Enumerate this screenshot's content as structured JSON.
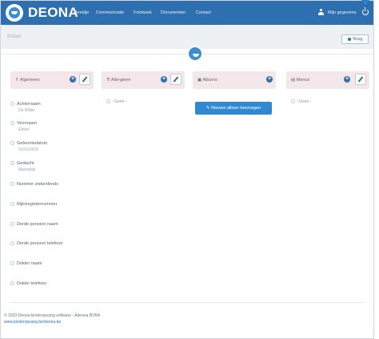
{
  "brand": "DEONA",
  "nav": {
    "links": [
      "Beeldje",
      "Communicatie",
      "Fotoboek",
      "Documenten",
      "Contact"
    ],
    "user_label": "Mijn gegevens"
  },
  "page": {
    "name": "Erbiet",
    "back_label": "Terug"
  },
  "columns": {
    "algemeen": {
      "title": "Algemeen",
      "fields": [
        {
          "label": "Achternaam",
          "value": "De Wilde"
        },
        {
          "label": "Voornaam",
          "value": "Erbiet"
        },
        {
          "label": "Geboortedatum",
          "value": "01/01/2019"
        },
        {
          "label": "Geslacht",
          "value": "Mannelijk"
        },
        {
          "label": "Nummer ziekenfonds",
          "value": ""
        },
        {
          "label": "Rijksregisternummer",
          "value": ""
        },
        {
          "label": "Derde persoon naam",
          "value": ""
        },
        {
          "label": "Derde persoon telefoon",
          "value": ""
        },
        {
          "label": "Dokter naam",
          "value": ""
        },
        {
          "label": "Dokter telefoon",
          "value": ""
        }
      ]
    },
    "allergieen": {
      "title": "Allergieen",
      "empty": "- Geen -"
    },
    "albums": {
      "title": "Albums",
      "button": "Nieuwe album toevoegen"
    },
    "menus": {
      "title": "Menus",
      "empty": "- Geen -"
    }
  },
  "footer": {
    "copyright": "© 2023 Deona kinderopvang software - Adeona BVBA",
    "link": "www.kinderopvang.be/deona.be"
  },
  "colors": {
    "nav_bg": "#2e6fb0",
    "accent": "#2f89d0",
    "col_header_bg": "#f4e7ea"
  }
}
